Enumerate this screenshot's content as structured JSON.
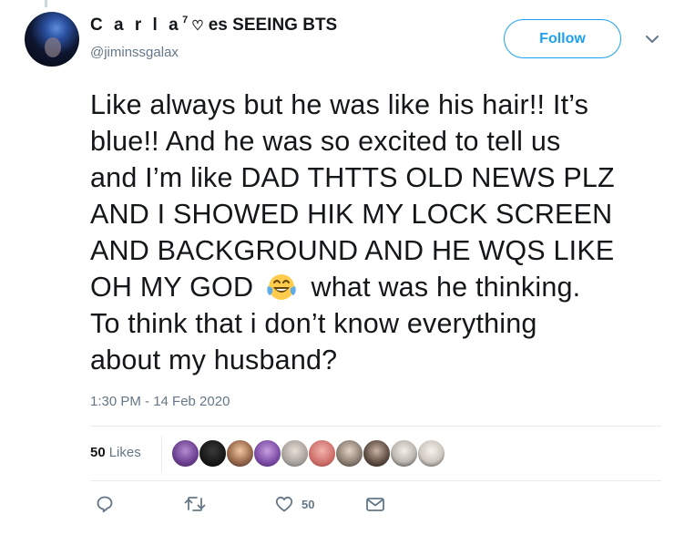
{
  "user": {
    "display_name": "C a r l a",
    "superscript": "7",
    "name_rest": "es SEEING BTS",
    "handle": "@jiminssgalax"
  },
  "follow_label": "Follow",
  "tweet": {
    "lines": [
      "Like always but he was like his hair!! It’s",
      "blue!! And he was so excited to tell us",
      "and I’m like DAD THTTS OLD NEWS PLZ",
      "AND I SHOWED HIK MY LOCK SCREEN",
      "AND BACKGROUND AND HE WQS LIKE",
      "OH MY GOD",
      "what was he thinking.",
      "To think that i don’t know everything",
      "about my husband?"
    ],
    "timestamp": "1:30 PM - 14 Feb 2020"
  },
  "likes": {
    "count": "50",
    "label": "Likes"
  },
  "actions": {
    "like_count": "50"
  },
  "colors": {
    "accent": "#1da1f2",
    "muted": "#657786",
    "text": "#14171a",
    "divider": "#e6ecf0"
  },
  "icons": [
    "heart-icon",
    "chevron-down-icon",
    "laughing-emoji-icon",
    "reply-icon",
    "retweet-icon",
    "like-icon",
    "message-icon"
  ]
}
